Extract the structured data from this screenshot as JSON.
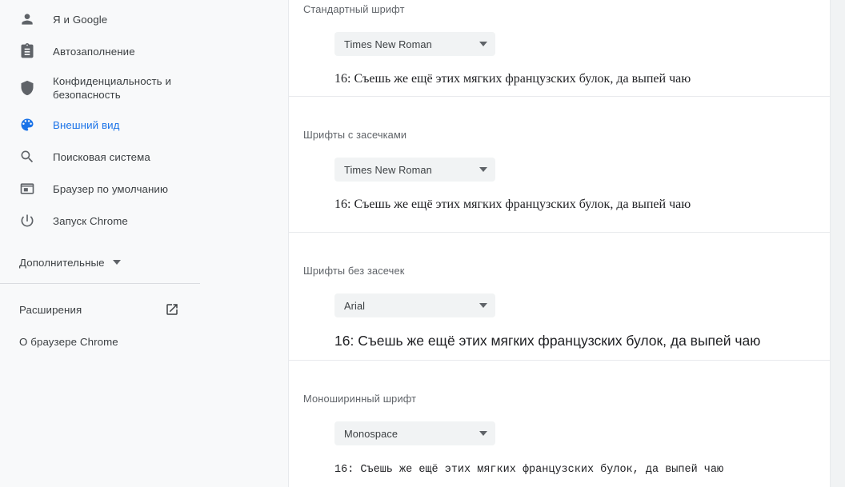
{
  "sidebar": {
    "items": [
      {
        "label": "Я и Google",
        "icon": "person-icon",
        "selected": false
      },
      {
        "label": "Автозаполнение",
        "icon": "clipboard-icon",
        "selected": false
      },
      {
        "label": "Конфиденциальность и безопасность",
        "icon": "shield-icon",
        "selected": false
      },
      {
        "label": "Внешний вид",
        "icon": "palette-icon",
        "selected": true
      },
      {
        "label": "Поисковая система",
        "icon": "search-icon",
        "selected": false
      },
      {
        "label": "Браузер по умолчанию",
        "icon": "browser-icon",
        "selected": false
      },
      {
        "label": "Запуск Chrome",
        "icon": "power-icon",
        "selected": false
      }
    ],
    "advanced": {
      "label": "Дополнительные",
      "icon": "chevron-down-icon"
    },
    "bottom": [
      {
        "label": "Расширения",
        "icon": "external-link-icon",
        "has_icon": true
      },
      {
        "label": "О браузере Chrome",
        "icon": "",
        "has_icon": false
      }
    ]
  },
  "main": {
    "sections": [
      {
        "label": "Стандартный шрифт",
        "select_value": "Times New Roman",
        "sample": "16: Съешь же ещё этих мягких французских булок, да выпей чаю",
        "sample_style": "serif"
      },
      {
        "label": "Шрифты с засечками",
        "select_value": "Times New Roman",
        "sample": "16: Съешь же ещё этих мягких французских булок, да выпей чаю",
        "sample_style": "serif"
      },
      {
        "label": "Шрифты без засечек",
        "select_value": "Arial",
        "sample": "16: Съешь же ещё этих мягких французских булок, да выпей чаю",
        "sample_style": "sans"
      },
      {
        "label": "Моноширинный шрифт",
        "select_value": "Monospace",
        "sample": "16: Съешь же ещё этих мягких французских булок, да выпей чаю",
        "sample_style": "mono"
      }
    ]
  },
  "colors": {
    "accent": "#1a73e8",
    "sidebar_bg": "#f8f9fa",
    "card_bg": "#ffffff",
    "select_bg": "#f1f3f4",
    "text_primary": "#202124",
    "text_secondary": "#5f6368",
    "divider": "#e8eaed"
  }
}
